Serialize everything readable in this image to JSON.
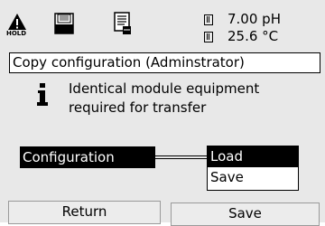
{
  "status_bar": {
    "hold_label": "HOLD",
    "measurements": [
      {
        "value": "7.00 pH"
      },
      {
        "value": "25.6 °C"
      }
    ]
  },
  "title": "Copy configuration (Adminstrator)",
  "info": {
    "icon": "info-icon",
    "message_line1": "Identical module equipment",
    "message_line2": "required for transfer"
  },
  "config": {
    "label": "Configuration",
    "options": [
      {
        "label": "Load",
        "selected": true
      },
      {
        "label": "Save",
        "selected": false
      }
    ]
  },
  "softkeys": {
    "left": "Return",
    "right": "Save"
  }
}
